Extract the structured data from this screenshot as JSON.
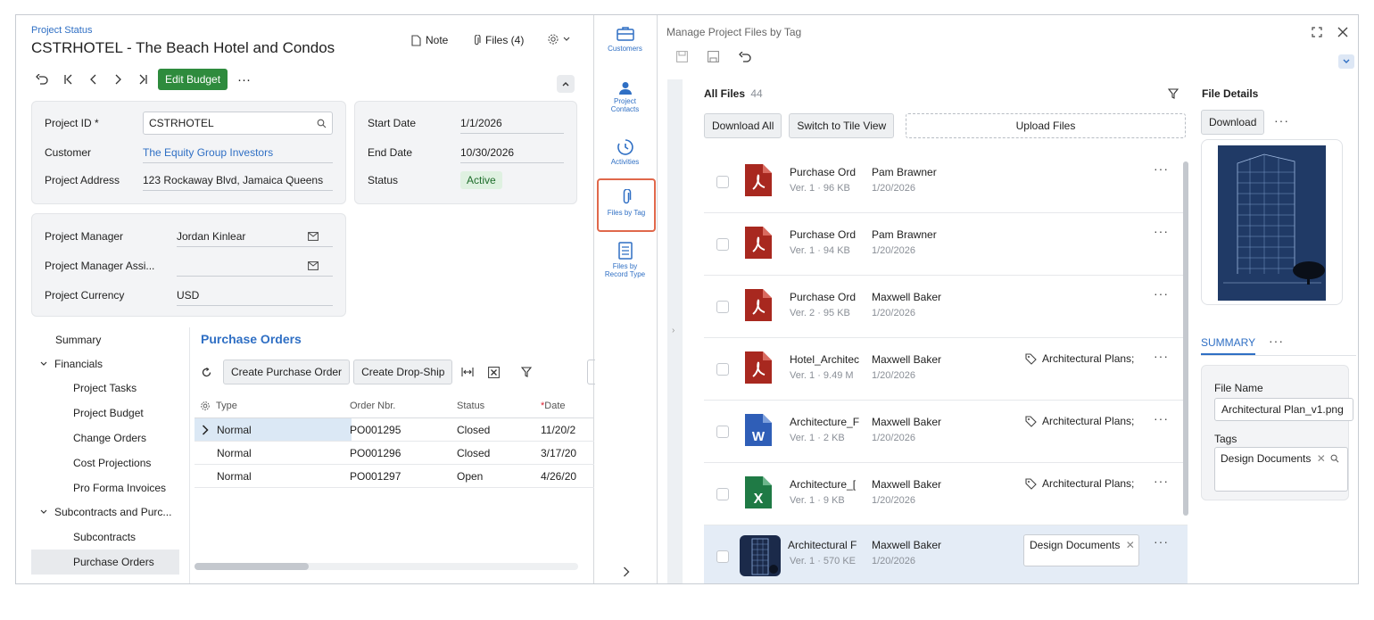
{
  "left": {
    "breadcrumb": "Project Status",
    "title": "CSTRHOTEL - The Beach Hotel and Condos",
    "header_actions": {
      "note": "Note",
      "files": "Files (4)"
    },
    "toolbar": {
      "edit_budget": "Edit Budget",
      "more": "···"
    },
    "summary_fields": [
      {
        "label": "Project ID *",
        "value": "CSTRHOTEL"
      },
      {
        "label": "Customer",
        "value": "The Equity Group Investors"
      },
      {
        "label": "Project Address",
        "value": "123 Rockaway Blvd, Jamaica Queens"
      }
    ],
    "date_fields": [
      {
        "label": "Start Date",
        "value": "1/1/2026"
      },
      {
        "label": "End Date",
        "value": "10/30/2026"
      },
      {
        "label": "Status",
        "value": "Active"
      }
    ],
    "manager_fields": [
      {
        "label": "Project Manager",
        "value": "Jordan Kinlear"
      },
      {
        "label": "Project Manager Assi...",
        "value": ""
      },
      {
        "label": "Project Currency",
        "value": "USD"
      }
    ],
    "nav": {
      "summary": "Summary",
      "financials": "Financials",
      "financials_items": [
        "Project Tasks",
        "Project Budget",
        "Change Orders",
        "Cost Projections",
        "Pro Forma Invoices"
      ],
      "subcontracts": "Subcontracts and Purc...",
      "subcontracts_items": [
        "Subcontracts",
        "Purchase Orders"
      ]
    },
    "po": {
      "title": "Purchase Orders",
      "create_po": "Create Purchase Order",
      "create_dropship": "Create Drop-Ship",
      "columns": [
        "Type",
        "Order Nbr.",
        "Status",
        "Date"
      ],
      "rows": [
        {
          "type": "Normal",
          "order": "PO001295",
          "status": "Closed",
          "date": "11/20/2"
        },
        {
          "type": "Normal",
          "order": "PO001296",
          "status": "Closed",
          "date": "3/17/20"
        },
        {
          "type": "Normal",
          "order": "PO001297",
          "status": "Open",
          "date": "4/26/20"
        }
      ]
    }
  },
  "sidebar": {
    "items": [
      "Customers",
      "Project Contacts",
      "Activities",
      "Files by Tag",
      "Files by Record Type"
    ],
    "active": "Files by Tag"
  },
  "manager": {
    "title": "Manage Project Files by Tag",
    "all_files_label": "All Files",
    "all_files_count": "44",
    "download_all": "Download All",
    "switch_view": "Switch to Tile View",
    "upload": "Upload Files",
    "files": [
      {
        "icon": "pdf",
        "name": "Purchase Ord",
        "meta": "Ver. 1 · 96 KB",
        "owner": "Pam Brawner",
        "date": "1/20/2026",
        "tag": ""
      },
      {
        "icon": "pdf",
        "name": "Purchase Ord",
        "meta": "Ver. 1 · 94 KB",
        "owner": "Pam Brawner",
        "date": "1/20/2026",
        "tag": ""
      },
      {
        "icon": "pdf",
        "name": "Purchase Ord",
        "meta": "Ver. 2 · 95 KB",
        "owner": "Maxwell Baker",
        "date": "1/20/2026",
        "tag": ""
      },
      {
        "icon": "pdf",
        "name": "Hotel_Architec",
        "meta": "Ver. 1 · 9.49 M",
        "owner": "Maxwell Baker",
        "date": "1/20/2026",
        "tag": "Architectural Plans;"
      },
      {
        "icon": "word",
        "name": "Architecture_F",
        "meta": "Ver. 1 · 2 KB",
        "owner": "Maxwell Baker",
        "date": "1/20/2026",
        "tag": "Architectural Plans;"
      },
      {
        "icon": "excel",
        "name": "Architecture_[",
        "meta": "Ver. 1 · 9 KB",
        "owner": "Maxwell Baker",
        "date": "1/20/2026",
        "tag": "Architectural Plans;"
      },
      {
        "icon": "image",
        "name": "Architectural F",
        "meta": "Ver. 1 · 570 KE",
        "owner": "Maxwell Baker",
        "date": "1/20/2026",
        "tag": "Design Documents"
      }
    ]
  },
  "details": {
    "title": "File Details",
    "download": "Download",
    "tab_summary": "SUMMARY",
    "file_name_label": "File Name",
    "file_name": "Architectural Plan_v1.png",
    "tags_label": "Tags",
    "tag_value": "Design Documents"
  },
  "colors": {
    "accent": "#2f6fc4",
    "green": "#2e8b3d",
    "pdf": "#a8281f",
    "word": "#2f5eb7",
    "excel": "#1f7a45",
    "active_outline": "#e0684b"
  }
}
